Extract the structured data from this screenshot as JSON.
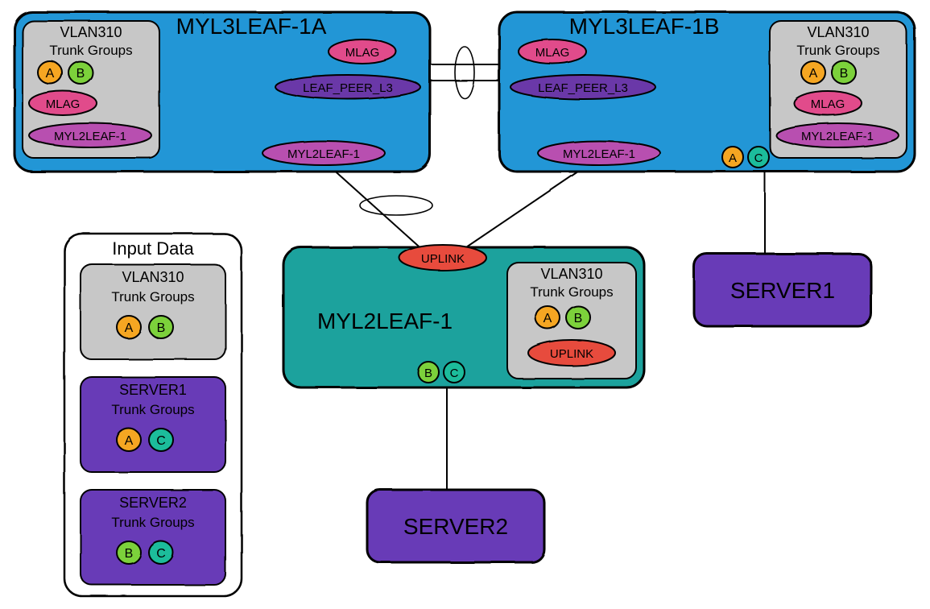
{
  "colors": {
    "blue": "#2196d6",
    "teal": "#1fa29d",
    "purple": "#673ab7",
    "grey": "#c7c7c7",
    "pink": "#e14b8b",
    "violet": "#6a39a8",
    "magenta": "#b84fb0",
    "orange": "#f5a623",
    "green": "#7bd13b",
    "tealDot": "#1bbc9b",
    "red": "#e74c3c",
    "darkPurple": "#5e35b1",
    "stroke": "#000"
  },
  "leaf1a": {
    "title": "MYL3LEAF-1A",
    "vlan": {
      "title": "VLAN310",
      "subtitle": "Trunk Groups",
      "a": "A",
      "b": "B",
      "mlag": "MLAG",
      "l2": "MYL2LEAF-1"
    },
    "mlag": "MLAG",
    "peer": "LEAF_PEER_L3",
    "l2": "MYL2LEAF-1"
  },
  "leaf1b": {
    "title": "MYL3LEAF-1B",
    "vlan": {
      "title": "VLAN310",
      "subtitle": "Trunk Groups",
      "a": "A",
      "b": "B",
      "mlag": "MLAG",
      "l2": "MYL2LEAF-1"
    },
    "mlag": "MLAG",
    "peer": "LEAF_PEER_L3",
    "l2": "MYL2LEAF-1",
    "portA": "A",
    "portC": "C"
  },
  "l2leaf": {
    "title": "MYL2LEAF-1",
    "uplink": "UPLINK",
    "vlan": {
      "title": "VLAN310",
      "subtitle": "Trunk Groups",
      "a": "A",
      "b": "B",
      "uplink": "UPLINK"
    },
    "portB": "B",
    "portC": "C"
  },
  "server1": {
    "title": "SERVER1"
  },
  "server2": {
    "title": "SERVER2"
  },
  "legend": {
    "title": "Input Data",
    "vlan": {
      "title": "VLAN310",
      "subtitle": "Trunk Groups",
      "a": "A",
      "b": "B"
    },
    "srv1": {
      "title": "SERVER1",
      "subtitle": "Trunk Groups",
      "a": "A",
      "c": "C"
    },
    "srv2": {
      "title": "SERVER2",
      "subtitle": "Trunk Groups",
      "b": "B",
      "c": "C"
    }
  }
}
